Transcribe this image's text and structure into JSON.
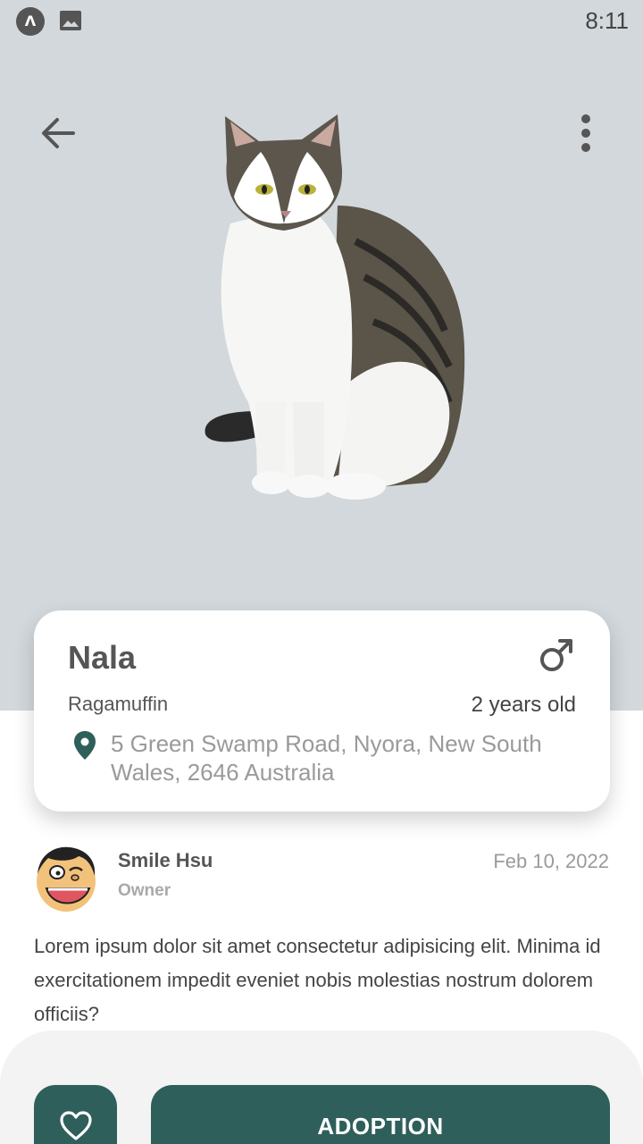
{
  "status_bar": {
    "time": "8:11",
    "app_badge": "Λ"
  },
  "pet": {
    "name": "Nala",
    "breed": "Ragamuffin",
    "age": "2 years old",
    "gender": "male",
    "address": "5 Green Swamp Road, Nyora, New South Wales, 2646 Australia"
  },
  "owner": {
    "name": "Smile Hsu",
    "role": "Owner",
    "date": "Feb 10, 2022"
  },
  "description": "Lorem ipsum dolor sit amet consectetur adipisicing elit. Minima id exercitationem impedit eveniet nobis molestias nostrum dolorem officiis?",
  "actions": {
    "adopt_label": "ADOPTION"
  },
  "colors": {
    "hero_bg": "#d2d8dc",
    "accent": "#2f5f5b",
    "panel_bg": "#f3f3f3"
  },
  "icons": [
    "back-arrow-icon",
    "more-vert-icon",
    "male-icon",
    "location-pin-icon",
    "heart-icon",
    "image-icon"
  ]
}
